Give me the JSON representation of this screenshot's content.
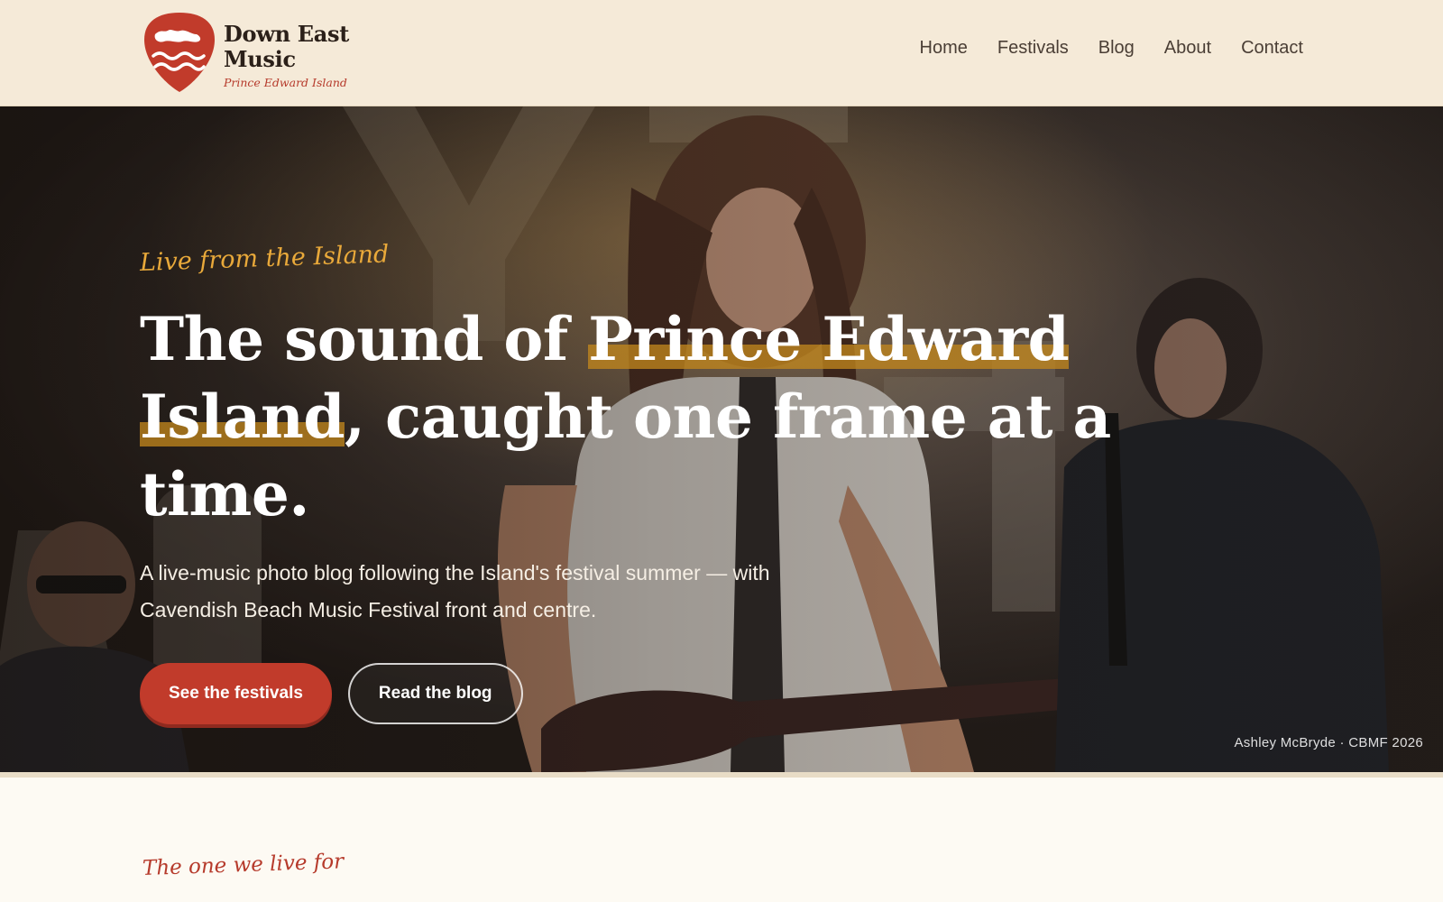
{
  "brand": {
    "name": "Down East Music",
    "tagline": "Prince Edward Island"
  },
  "nav": {
    "items": [
      {
        "label": "Home"
      },
      {
        "label": "Festivals"
      },
      {
        "label": "Blog"
      },
      {
        "label": "About"
      },
      {
        "label": "Contact"
      }
    ]
  },
  "hero": {
    "eyebrow": "Live from the Island",
    "title_before": "The sound of ",
    "title_highlight": "Prince Edward Island",
    "title_after": ", caught one frame at a time.",
    "lede": "A live-music photo blog following the Island's festival summer — with Cavendish Beach Music Festival front and centre.",
    "primary_cta": "See the festivals",
    "secondary_cta": "Read the blog",
    "photo_credit": "Ashley McBryde · CBMF 2026"
  },
  "next_section": {
    "eyebrow": "The one we live for"
  },
  "colors": {
    "header_bg": "#f5ead8",
    "accent_red": "#c13b2b",
    "accent_gold": "#e9a93a",
    "page_bg": "#fdfaf3"
  },
  "icons": {
    "logo": "guitar-pick-island-icon"
  }
}
